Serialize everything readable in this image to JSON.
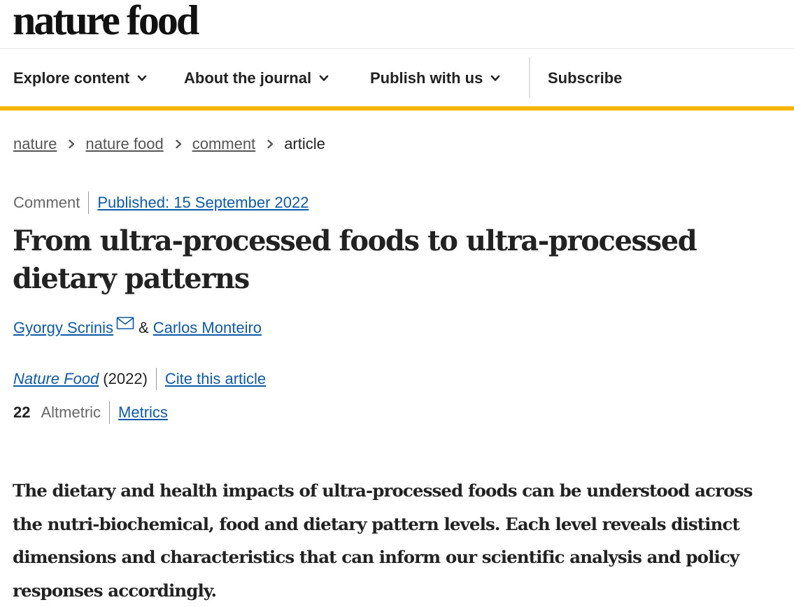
{
  "site": {
    "logo_text": "nature food"
  },
  "nav": {
    "items": [
      {
        "label": "Explore content",
        "has_dropdown": true
      },
      {
        "label": "About the journal",
        "has_dropdown": true
      },
      {
        "label": "Publish with us",
        "has_dropdown": true
      },
      {
        "label": "Subscribe",
        "has_dropdown": false
      }
    ],
    "accent_color": "#f7b500"
  },
  "breadcrumb": {
    "items": [
      "nature",
      "nature food",
      "comment"
    ],
    "current": "article"
  },
  "article": {
    "type": "Comment",
    "published": "Published: 15 September 2022",
    "title": "From ultra-processed foods to ultra-processed dietary patterns",
    "authors": [
      {
        "name": "Gyorgy Scrinis",
        "has_email_icon": true
      },
      {
        "name": "Carlos Monteiro",
        "has_email_icon": false
      }
    ],
    "author_joiner": "&",
    "journal": "Nature Food",
    "year": "(2022)",
    "cite_label": "Cite this article",
    "altmetric_score": "22",
    "altmetric_label": "Altmetric",
    "metrics_label": "Metrics",
    "standfirst": "The dietary and health impacts of ultra-processed foods can be understood across the nutri-biochemical, food and dietary pattern levels. Each level reveals distinct dimensions and characteristics that can inform our scientific analysis and policy responses accordingly."
  },
  "icons": {
    "nav_dropdown": "chevron-down-icon",
    "breadcrumb_separator": "chevron-right-icon",
    "author_contact": "envelope-icon"
  },
  "colors": {
    "link": "#0e5aa8",
    "text": "#222222",
    "muted": "#666666"
  }
}
